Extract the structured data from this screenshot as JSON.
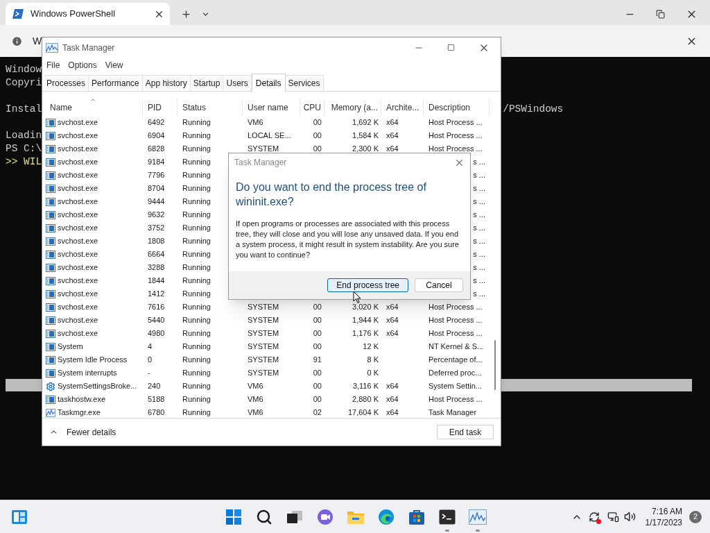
{
  "terminal": {
    "tab_title": "Windows PowerShell",
    "info_text": "W",
    "lines": [
      {
        "kind": "text",
        "text": "Window"
      },
      {
        "kind": "text",
        "text": "Copyri"
      },
      {
        "kind": "blank"
      },
      {
        "kind": "text",
        "text": "Instal",
        "right": "/PSWindows"
      },
      {
        "kind": "blank"
      },
      {
        "kind": "text",
        "text": "Loadin"
      },
      {
        "kind": "text",
        "text": "PS C:\\"
      },
      {
        "kind": "input",
        "text": ">> WIL"
      }
    ]
  },
  "task_manager": {
    "title": "Task Manager",
    "menu": [
      "File",
      "Options",
      "View"
    ],
    "tabs": [
      {
        "label": "Processes",
        "selected": false
      },
      {
        "label": "Performance",
        "selected": false
      },
      {
        "label": "App history",
        "selected": false
      },
      {
        "label": "Startup",
        "selected": false
      },
      {
        "label": "Users",
        "selected": false
      },
      {
        "label": "Details",
        "selected": true
      },
      {
        "label": "Services",
        "selected": false
      }
    ],
    "columns": [
      {
        "label": "Name",
        "sorted": true
      },
      {
        "label": "PID",
        "sorted": false
      },
      {
        "label": "Status",
        "sorted": false
      },
      {
        "label": "User name",
        "sorted": false
      },
      {
        "label": "CPU",
        "sorted": false
      },
      {
        "label": "Memory (a...",
        "sorted": false
      },
      {
        "label": "Archite...",
        "sorted": false
      },
      {
        "label": "Description",
        "sorted": false
      }
    ],
    "rows": [
      {
        "kind": "window",
        "name": "svchost.exe",
        "pid": "6492",
        "status": "Running",
        "user": "VM6",
        "cpu": "00",
        "memory": "1,692 K",
        "arch": "x64",
        "description": "Host Process ..."
      },
      {
        "kind": "window",
        "name": "svchost.exe",
        "pid": "6904",
        "status": "Running",
        "user": "LOCAL SE...",
        "cpu": "00",
        "memory": "1,584 K",
        "arch": "x64",
        "description": "Host Process ..."
      },
      {
        "kind": "window",
        "name": "svchost.exe",
        "pid": "6828",
        "status": "Running",
        "user": "SYSTEM",
        "cpu": "00",
        "memory": "2,300 K",
        "arch": "x64",
        "description": "Host Process ..."
      },
      {
        "kind": "window",
        "name": "svchost.exe",
        "pid": "9184",
        "status": "Running",
        "description_tail": "s ..."
      },
      {
        "kind": "window",
        "name": "svchost.exe",
        "pid": "7796",
        "status": "Running",
        "description_tail": "s ..."
      },
      {
        "kind": "window",
        "name": "svchost.exe",
        "pid": "8704",
        "status": "Running",
        "description_tail": "s ..."
      },
      {
        "kind": "window",
        "name": "svchost.exe",
        "pid": "9444",
        "status": "Running",
        "description_tail": "s ..."
      },
      {
        "kind": "window",
        "name": "svchost.exe",
        "pid": "9632",
        "status": "Running",
        "description_tail": "s ..."
      },
      {
        "kind": "window",
        "name": "svchost.exe",
        "pid": "3752",
        "status": "Running",
        "description_tail": "s ..."
      },
      {
        "kind": "window",
        "name": "svchost.exe",
        "pid": "1808",
        "status": "Running",
        "description_tail": "s ..."
      },
      {
        "kind": "window",
        "name": "svchost.exe",
        "pid": "6664",
        "status": "Running",
        "description_tail": "s ..."
      },
      {
        "kind": "window",
        "name": "svchost.exe",
        "pid": "3288",
        "status": "Running",
        "description_tail": "s ..."
      },
      {
        "kind": "window",
        "name": "svchost.exe",
        "pid": "1844",
        "status": "Running",
        "description_tail": "s ..."
      },
      {
        "kind": "window",
        "name": "svchost.exe",
        "pid": "1412",
        "status": "Running",
        "description_tail": "s ..."
      },
      {
        "kind": "window",
        "name": "svchost.exe",
        "pid": "7616",
        "status": "Running",
        "user": "SYSTEM",
        "cpu": "00",
        "memory": "3,020 K",
        "arch": "x64",
        "description": "Host Process ..."
      },
      {
        "kind": "window",
        "name": "svchost.exe",
        "pid": "5440",
        "status": "Running",
        "user": "SYSTEM",
        "cpu": "00",
        "memory": "1,944 K",
        "arch": "x64",
        "description": "Host Process ..."
      },
      {
        "kind": "window",
        "name": "svchost.exe",
        "pid": "4980",
        "status": "Running",
        "user": "SYSTEM",
        "cpu": "00",
        "memory": "1,176 K",
        "arch": "x64",
        "description": "Host Process ..."
      },
      {
        "kind": "window",
        "name": "System",
        "pid": "4",
        "status": "Running",
        "user": "SYSTEM",
        "cpu": "00",
        "memory": "12 K",
        "description": "NT Kernel & S..."
      },
      {
        "kind": "window",
        "name": "System Idle Process",
        "pid": "0",
        "status": "Running",
        "user": "SYSTEM",
        "cpu": "91",
        "memory": "8 K",
        "description": "Percentage of..."
      },
      {
        "kind": "window",
        "name": "System interrupts",
        "pid": "-",
        "status": "Running",
        "user": "SYSTEM",
        "cpu": "00",
        "memory": "0 K",
        "description": "Deferred proc..."
      },
      {
        "kind": "gear",
        "name": "SystemSettingsBroke...",
        "pid": "240",
        "status": "Running",
        "user": "VM6",
        "cpu": "00",
        "memory": "3,116 K",
        "arch": "x64",
        "description": "System Settin..."
      },
      {
        "kind": "window",
        "name": "taskhostw.exe",
        "pid": "5188",
        "status": "Running",
        "user": "VM6",
        "cpu": "00",
        "memory": "2,880 K",
        "arch": "x64",
        "description": "Host Process ..."
      },
      {
        "kind": "chart",
        "name": "Taskmgr.exe",
        "pid": "6780",
        "status": "Running",
        "user": "VM6",
        "cpu": "02",
        "memory": "17,604 K",
        "arch": "x64",
        "description": "Task Manager"
      }
    ],
    "fewer_details": "Fewer details",
    "end_task": "End task"
  },
  "dialog": {
    "title": "Task Manager",
    "heading": "Do you want to end the process tree of wininit.exe?",
    "body": "If open programs or processes are associated with this process tree, they will close and you will lose any unsaved data. If you end a system process, it might result in system instability. Are you sure you want to continue?",
    "buttons": [
      {
        "label": "End process tree",
        "default": true
      },
      {
        "label": "Cancel",
        "default": false
      }
    ]
  },
  "taskbar": {
    "apps": [
      {
        "kind": "start",
        "running": false
      },
      {
        "kind": "search",
        "running": false
      },
      {
        "kind": "taskview",
        "running": false
      },
      {
        "kind": "chat",
        "running": false
      },
      {
        "kind": "folder",
        "running": false
      },
      {
        "kind": "browser",
        "running": false
      },
      {
        "kind": "store",
        "running": false
      },
      {
        "kind": "terminal",
        "running": true
      },
      {
        "kind": "monitor",
        "running": true
      }
    ],
    "time": "7:16 AM",
    "date": "1/17/2023",
    "notifications": "2"
  }
}
